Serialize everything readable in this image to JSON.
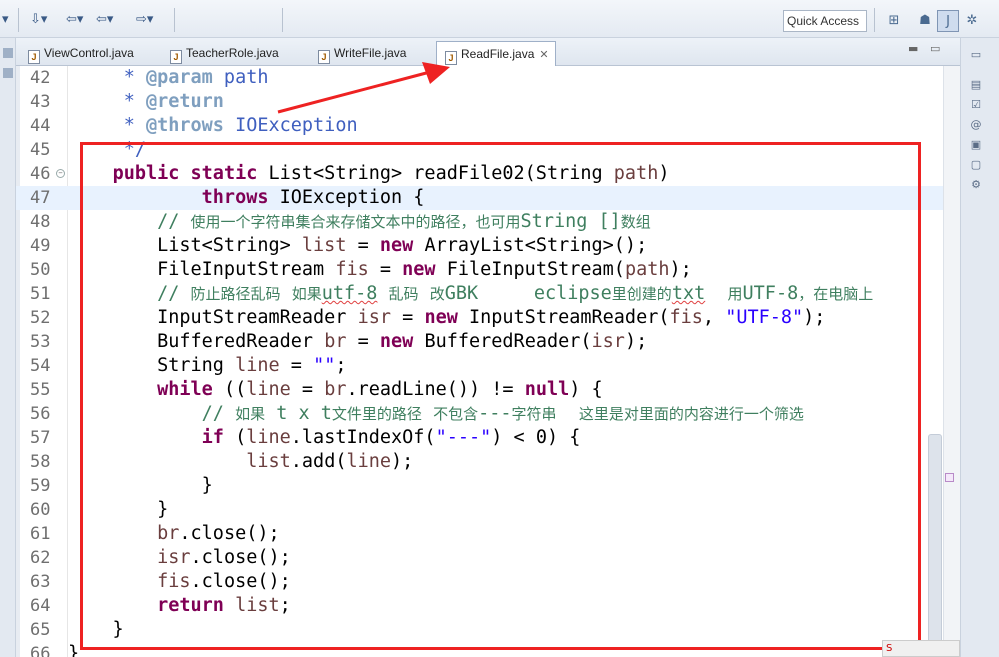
{
  "toolbar": {
    "quick_access": "Quick Access"
  },
  "tabs": [
    {
      "label": "ViewControl.java",
      "active": false
    },
    {
      "label": "TeacherRole.java",
      "active": false
    },
    {
      "label": "WriteFile.java",
      "active": false
    },
    {
      "label": "ReadFile.java",
      "active": true
    }
  ],
  "editor": {
    "lines": [
      {
        "num": "42",
        "text": "     * @param path"
      },
      {
        "num": "43",
        "text": "     * @return"
      },
      {
        "num": "44",
        "text": "     * @throws IOException"
      },
      {
        "num": "45",
        "text": "     */"
      },
      {
        "num": "46",
        "text": "    public static List<String> readFile02(String path)"
      },
      {
        "num": "47",
        "text": "            throws IOException {"
      },
      {
        "num": "48",
        "text": "        // 使用一个字符串集合来存储文本中的路径，也可用String []数组"
      },
      {
        "num": "49",
        "text": "        List<String> list = new ArrayList<String>();"
      },
      {
        "num": "50",
        "text": "        FileInputStream fis = new FileInputStream(path);"
      },
      {
        "num": "51",
        "text": "        // 防止路径乱码 如果utf-8 乱码 改GBK     eclipse里创建的txt  用UTF-8，在电脑上"
      },
      {
        "num": "52",
        "text": "        InputStreamReader isr = new InputStreamReader(fis, \"UTF-8\");"
      },
      {
        "num": "53",
        "text": "        BufferedReader br = new BufferedReader(isr);"
      },
      {
        "num": "54",
        "text": "        String line = \"\";"
      },
      {
        "num": "55",
        "text": "        while ((line = br.readLine()) != null) {"
      },
      {
        "num": "56",
        "text": "            // 如果 t x t文件里的路径 不包含---字符串  这里是对里面的内容进行一个筛选"
      },
      {
        "num": "57",
        "text": "            if (line.lastIndexOf(\"---\") < 0) {"
      },
      {
        "num": "58",
        "text": "                list.add(line);"
      },
      {
        "num": "59",
        "text": "            }"
      },
      {
        "num": "60",
        "text": "        }"
      },
      {
        "num": "61",
        "text": "        br.close();"
      },
      {
        "num": "62",
        "text": "        isr.close();"
      },
      {
        "num": "63",
        "text": "        fis.close();"
      },
      {
        "num": "64",
        "text": "        return list;"
      },
      {
        "num": "65",
        "text": "    }"
      },
      {
        "num": "66",
        "text": "}"
      }
    ]
  },
  "ime_indicator": "S"
}
